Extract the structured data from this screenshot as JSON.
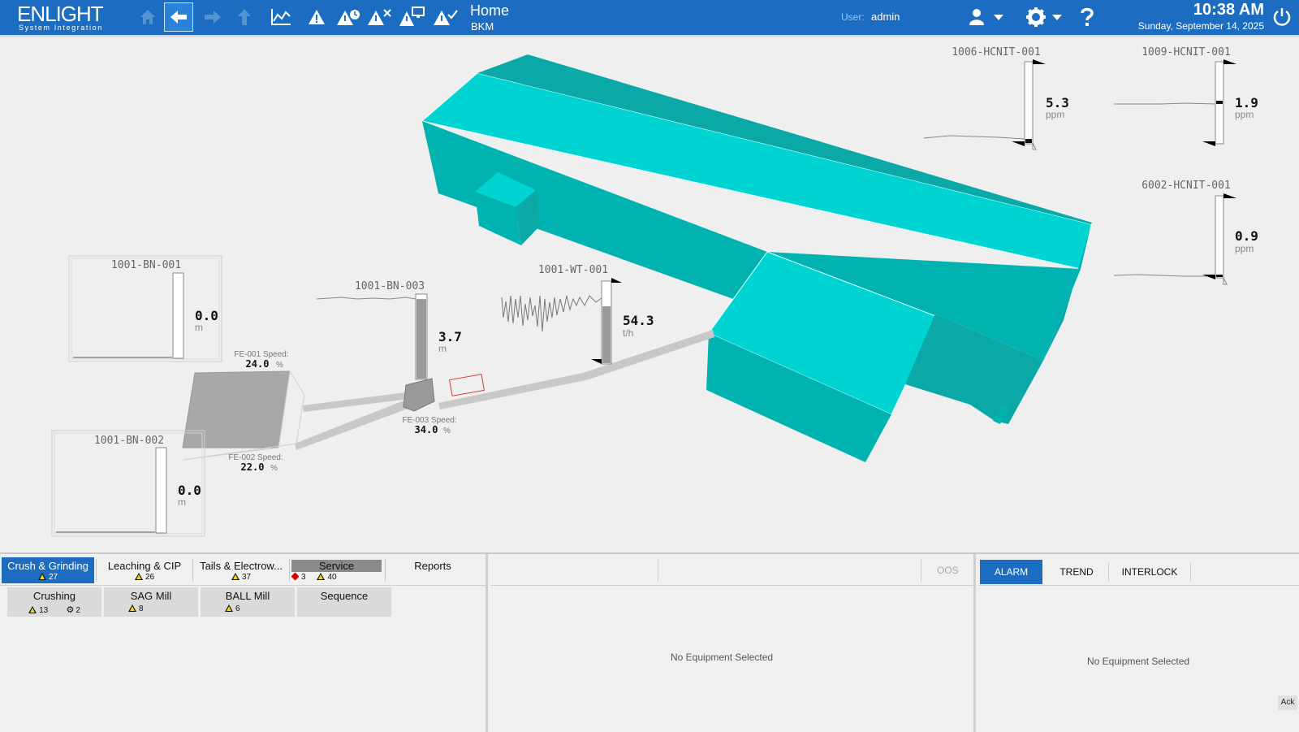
{
  "header": {
    "logo_text": "ENLIGHT",
    "logo_sub": "System Integration",
    "title": "Home",
    "subtitle": "BKM",
    "user_label": "User:",
    "user_name": "admin",
    "time": "10:38 AM",
    "date": "Sunday, September 14, 2025",
    "toolbar_icons": [
      "home-icon",
      "back-arrow-icon",
      "forward-arrow-icon",
      "up-arrow-icon",
      "trend-chart-icon",
      "alarm-icon",
      "alarm-shelved-icon",
      "alarm-suppressed-icon",
      "alarm-station-icon",
      "alarm-ack-icon"
    ],
    "right_icons": [
      "user-icon",
      "chevron-down-icon",
      "gear-icon",
      "chevron-down-icon",
      "help-icon",
      "power-icon"
    ]
  },
  "colors": {
    "header_bg": "#1c6dc1",
    "building_top": "#00d4d2",
    "building_side": "#00b8b6",
    "building_dark": "#0a9f9d",
    "conveyor": "#c8c8c8",
    "warning": "#f5d41c",
    "alarm": "#d40000"
  },
  "graphic": {
    "bin_001": {
      "tag": "1001-BN-001",
      "value": "0.0",
      "unit": "m",
      "level": 0
    },
    "bin_002": {
      "tag": "1001-BN-002",
      "value": "0.0",
      "unit": "m",
      "level": 0
    },
    "bin_003": {
      "tag": "1001-BN-003",
      "value": "3.7",
      "unit": "m",
      "level": 0.95
    },
    "weigher": {
      "tag": "1001-WT-001",
      "value": "54.3",
      "unit": "t/h",
      "level": 0.7
    },
    "fe_001": {
      "label": "FE-001 Speed:",
      "value": "24.0",
      "unit": "%"
    },
    "fe_002": {
      "label": "FE-002 Speed:",
      "value": "22.0",
      "unit": "%"
    },
    "fe_003": {
      "label": "FE-003 Speed:",
      "value": "34.0",
      "unit": "%"
    },
    "hcn_1006": {
      "tag": "1006-HCNIT-001",
      "value": "5.3",
      "unit": "ppm",
      "level": 0.05
    },
    "hcn_1009": {
      "tag": "1009-HCNIT-001",
      "value": "1.9",
      "unit": "ppm",
      "level": 0.5
    },
    "hcn_6002": {
      "tag": "6002-HCNIT-001",
      "value": "0.9",
      "unit": "ppm",
      "level": 0.03
    }
  },
  "nav": {
    "areas": [
      {
        "label": "Crush & Grinding",
        "warn": "27"
      },
      {
        "label": "Leaching & CIP",
        "warn": "26"
      },
      {
        "label": "Tails & Electrow...",
        "warn": "37"
      },
      {
        "label": "Service",
        "alarm": "3",
        "warn": "40"
      },
      {
        "label": "Reports"
      }
    ],
    "sub_areas": [
      {
        "label": "Crushing",
        "warn": "13",
        "other": "2"
      },
      {
        "label": "SAG Mill",
        "warn": "8"
      },
      {
        "label": "BALL Mill",
        "warn": "6"
      },
      {
        "label": "Sequence"
      }
    ]
  },
  "equipment": {
    "oos_label": "OOS",
    "empty_msg": "No Equipment Selected"
  },
  "alarm_panel": {
    "tabs": [
      "ALARM",
      "TREND",
      "INTERLOCK"
    ],
    "empty_msg": "No Equipment Selected",
    "ack_label": "Ack"
  }
}
